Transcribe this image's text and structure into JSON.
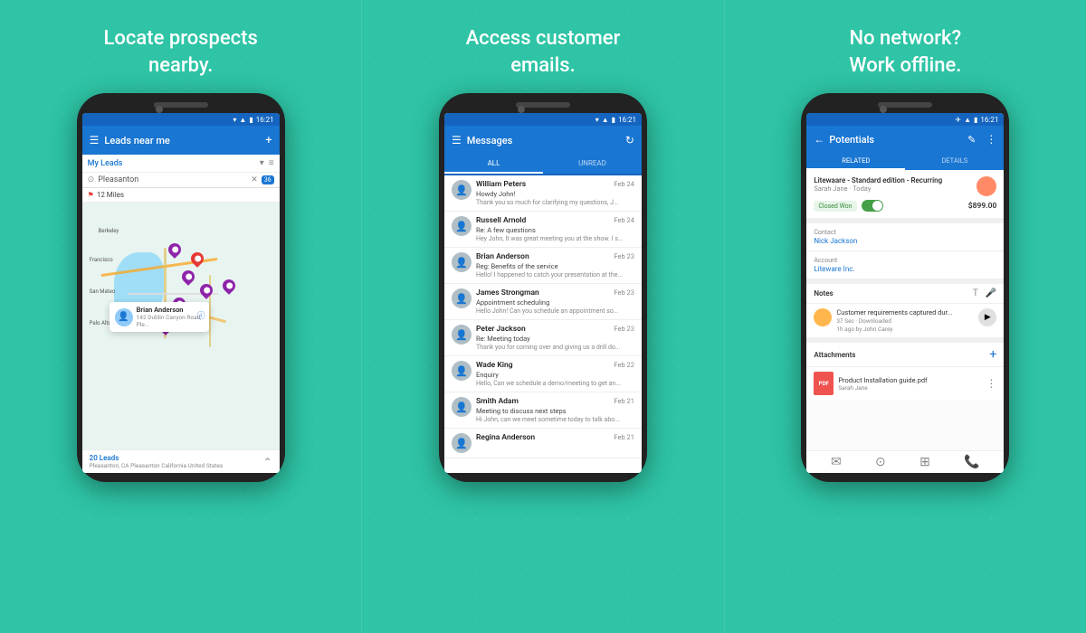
{
  "panels": [
    {
      "id": "panel1",
      "title_line1": "Locate prospects",
      "title_line2": "nearby.",
      "screen": {
        "app_bar": {
          "title": "Leads near me",
          "icon_plus": "+"
        },
        "filter": "My Leads",
        "search_placeholder": "Pleasanton",
        "miles": "12 Miles",
        "popup": {
          "name": "Brian Anderson",
          "address": "142 Dublin Canyon Road, Ple..."
        },
        "footer": {
          "leads_count": "20 Leads",
          "location": "Pleasanton, CA Pleasanton California United States"
        }
      }
    },
    {
      "id": "panel2",
      "title_line1": "Access customer",
      "title_line2": "emails.",
      "screen": {
        "app_bar": {
          "title": "Messages"
        },
        "tabs": [
          "ALL",
          "UNREAD"
        ],
        "messages": [
          {
            "name": "William Peters",
            "date": "Feb 24",
            "subject": "Howdy John!",
            "preview": "Thank you so much for clarifying my questions, J..."
          },
          {
            "name": "Russell Arnold",
            "date": "Feb 24",
            "subject": "Re: A few questions",
            "preview": "Hey John, It was great meeting you at the show. I s..."
          },
          {
            "name": "Brian Anderson",
            "date": "Feb 23",
            "subject": "Reg: Benefits of the service",
            "preview": "Hello! I happened to catch your presentation at the..."
          },
          {
            "name": "James Strongman",
            "date": "Feb 23",
            "subject": "Appointment scheduling",
            "preview": "Hello John! Can you schedule an appointment so..."
          },
          {
            "name": "Peter Jackson",
            "date": "Feb 23",
            "subject": "Re: Meeting today",
            "preview": "Thank you for coming over and giving us a drill do..."
          },
          {
            "name": "Wade King",
            "date": "Feb 22",
            "subject": "Enquiry",
            "preview": "Hello, Can we schedule a demo/meeting to get an..."
          },
          {
            "name": "Smith Adam",
            "date": "Feb 21",
            "subject": "Meeting to discuss next steps",
            "preview": "Hi John, can we meet sometime today to talk abo..."
          },
          {
            "name": "Regina Anderson",
            "date": "Feb 21",
            "subject": "",
            "preview": ""
          }
        ]
      }
    },
    {
      "id": "panel3",
      "title_line1": "No network?",
      "title_line2": "Work offline.",
      "screen": {
        "app_bar": {
          "title": "Potentials"
        },
        "tabs": [
          "RELATED",
          "DETAILS"
        ],
        "deal": {
          "title": "Litewaare - Standard edition - Recurring",
          "subtitle": "Sarah Jane · Today",
          "status": "Closed Won",
          "amount": "$899.00"
        },
        "contact_label": "Contact",
        "contact_name": "Nick Jackson",
        "account_label": "Account",
        "account_name": "Liteware Inc.",
        "notes_title": "Notes",
        "note": {
          "text": "Customer requirements captured dur...",
          "meta": "37 Sec · Downloaded",
          "timestamp": "1h ago by John Carey"
        },
        "attachments_title": "Attachments",
        "attachment": {
          "name": "Product Installation guide.pdf",
          "author": "Sarah Jane"
        }
      }
    }
  ]
}
